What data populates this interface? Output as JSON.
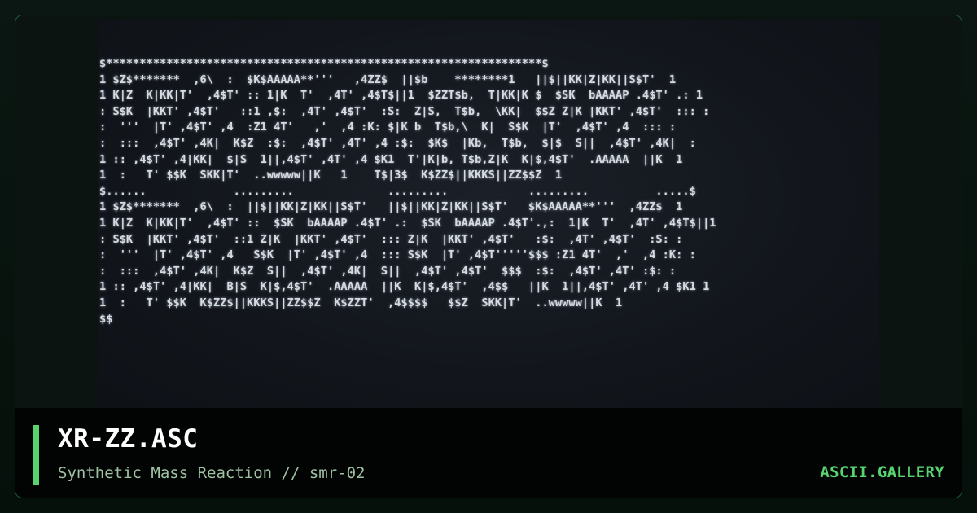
{
  "artwork": {
    "ascii_lines": [
      "$*****************************************************************$",
      "1 $Z$*******  ,6\\  :  $K$AAAAA**'''   ,4ZZ$  ||$b    ********1   ||$||KK|Z|KK||S$T'  1",
      "1 K|Z  K|KK|T'  ,4$T' :: 1|K  T'  ,4T' ,4$T$||1  $ZZT$b,  T|KK|K $  $SK  bAAAAP .4$T' .: 1",
      ": S$K  |KKT' ,4$T'   ::1 ,$:  ,4T' ,4$T'  :S:  Z|S,  T$b,  \\KK|  $$Z Z|K |KKT' ,4$T'  ::: :",
      ":  '''  |T' ,4$T' ,4  :Z1 4T'   ,'  ,4 :K: $|K b  T$b,\\  K|  S$K  |T'  ,4$T' ,4  ::: :",
      ":  :::  ,4$T' ,4K|  K$Z  :$:  ,4$T' ,4T' ,4 :$:  $K$  |Kb,  T$b,  $|$  S||  ,4$T' ,4K|  :",
      "1 :: ,4$T' ,4|KK|  $|S  1||,4$T' ,4T' ,4 $K1  T'|K|b, T$b,Z|K  K|$,4$T'  .AAAAA  ||K  1",
      "1  :   T' $$K  SKK|T'  ..wwwww||K   1    T$|3$  K$ZZ$||KKKS||ZZ$$Z  1",
      "$......             .........              .........            .........          .....$",
      "1 $Z$*******  ,6\\  :  ||$||KK|Z|KK||S$T'   ||$||KK|Z|KK||S$T'   $K$AAAAA**'''  ,4ZZ$  1",
      "1 K|Z  K|KK|T'  ,4$T' ::  $SK  bAAAAP .4$T' .:  $SK  bAAAAP .4$T'.,:  1|K  T'  ,4T' ,4$T$||1",
      ": S$K  |KKT' ,4$T'  ::1 Z|K  |KKT' ,4$T'  ::: Z|K  |KKT' ,4$T'   :$:  ,4T' ,4$T'  :S: :",
      ":  '''  |T' ,4$T' ,4   S$K  |T' ,4$T' ,4  ::: S$K  |T' ,4$T'''''$$$ :Z1 4T'  ,'  ,4 :K: :",
      ":  :::  ,4$T' ,4K|  K$Z  S||  ,4$T' ,4K|  S||  ,4$T' ,4$T'  $$$  :$:  ,4$T' ,4T' :$: :",
      "1 :: ,4$T' ,4|KK|  B|S  K|$,4$T'  .AAAAA  ||K  K|$,4$T'  ,4$$   ||K  1||,4$T' ,4T' ,4 $K1 1",
      "1  :   T' $$K  K$ZZ$||KKKS||ZZ$$Z  K$ZZT'  ,4$$$$   $$Z  SKK|T'  ..wwwww||K  1",
      "$$"
    ]
  },
  "caption": {
    "title": "XR-ZZ.ASC",
    "subtitle": "Synthetic Mass Reaction // smr-02",
    "brand": "ASCII.GALLERY"
  },
  "colors": {
    "accent": "#57d36f",
    "title": "#ffffff",
    "subtitle": "#9fc2a3",
    "ascii": "#d6dbe2"
  }
}
